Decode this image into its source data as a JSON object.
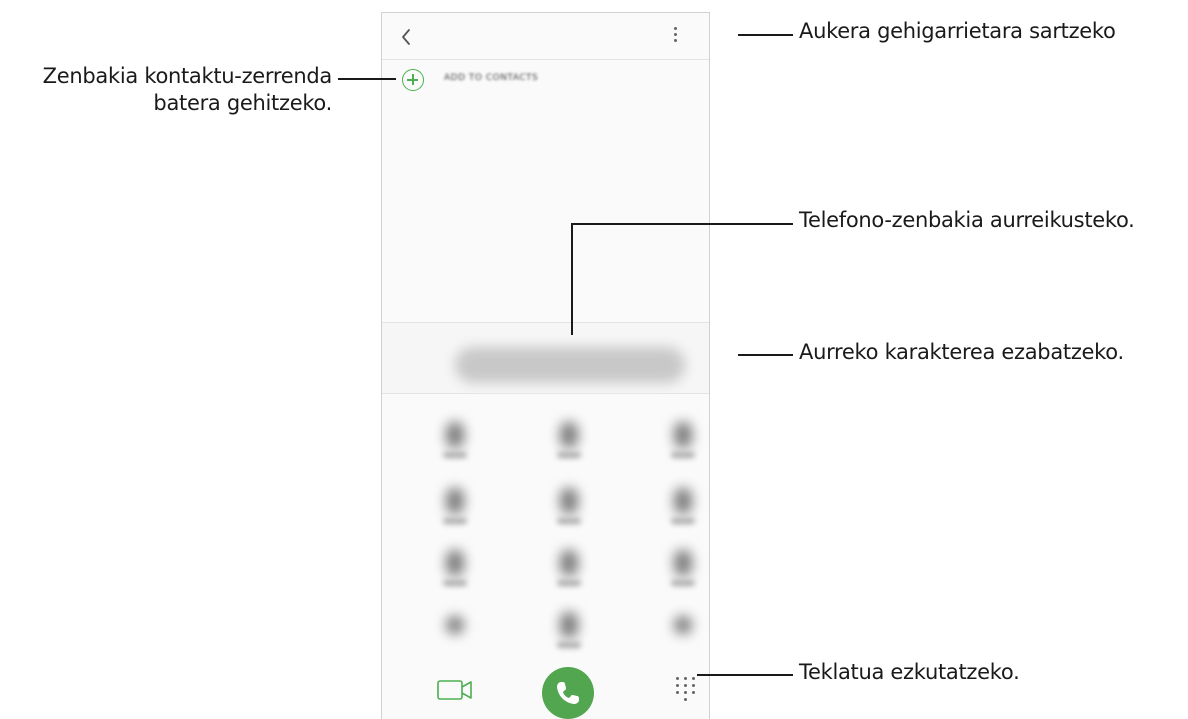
{
  "screen": {
    "add_to_contacts_label": "ADD TO CONTACTS"
  },
  "annotations": {
    "more_options": "Aukera gehigarrietara sartzeko",
    "add_to_contacts_line1": "Zenbakia kontaktu-zerrenda",
    "add_to_contacts_line2": "batera gehitzeko.",
    "preview_number": "Telefono-zenbakia aurreikusteko.",
    "delete_previous": "Aurreko karakterea ezabatzeko.",
    "hide_keypad": "Teklatua ezkutatzeko."
  },
  "icons": {
    "back": "chevron-left-icon",
    "more": "more-vertical-icon",
    "add": "plus-circle-icon",
    "backspace": "backspace-icon",
    "video_call": "video-call-icon",
    "voice_call": "phone-icon",
    "keypad": "dialpad-icon"
  },
  "colors": {
    "accent_green": "#52a64f",
    "annotation_line": "#1a1a1a"
  }
}
